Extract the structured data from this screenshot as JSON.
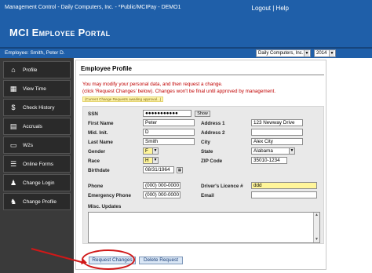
{
  "header": {
    "crumb": "Management Control - Daily Computers, Inc. - *Public/MCIPay - DEMO1",
    "logout": "Logout",
    "separator": "|",
    "help": "Help",
    "app_title": "MCI Employee Portal"
  },
  "employee_bar": {
    "employee": "Employee: Smith, Peter D.",
    "company": "Daily Computers, Inc.",
    "year": "2014"
  },
  "sidebar": {
    "items": [
      {
        "label": "Profile",
        "icon": "house-icon",
        "glyph": "⌂"
      },
      {
        "label": "View Time",
        "icon": "grid-icon",
        "glyph": "▦"
      },
      {
        "label": "Check History",
        "icon": "money-bag-icon",
        "glyph": "$"
      },
      {
        "label": "Accruals",
        "icon": "calendar-icon",
        "glyph": "▤"
      },
      {
        "label": "W2s",
        "icon": "document-icon",
        "glyph": "▭"
      },
      {
        "label": "Online Forms",
        "icon": "forms-icon",
        "glyph": "☰"
      },
      {
        "label": "Change Login",
        "icon": "person-icon",
        "glyph": "♟"
      },
      {
        "label": "Change Profile",
        "icon": "person-edit-icon",
        "glyph": "♞"
      }
    ]
  },
  "panel": {
    "title": "Employee Profile",
    "note1": "You may modify your personal data, and then request a change.",
    "note2": "(click 'Request Changes' below). Changes won't be final until approved by management.",
    "badge": "(Current Change Requests awaiting approval...)"
  },
  "form": {
    "ssn": {
      "label": "SSN",
      "value": "●●●●●●●●●●●",
      "show": "Show"
    },
    "first_name": {
      "label": "First Name",
      "value": "Peter"
    },
    "mid_init": {
      "label": "Mid. Init.",
      "value": "D"
    },
    "last_name": {
      "label": "Last Name",
      "value": "Smith"
    },
    "gender": {
      "label": "Gender",
      "value": "F"
    },
    "race": {
      "label": "Race",
      "value": "H"
    },
    "birthdate": {
      "label": "Birthdate",
      "value": "08/31/1964"
    },
    "address1": {
      "label": "Address 1",
      "value": "123 Newway Drive"
    },
    "address2": {
      "label": "Address 2",
      "value": ""
    },
    "city": {
      "label": "City",
      "value": "Alex City"
    },
    "state": {
      "label": "State",
      "value": "Alabama"
    },
    "zip": {
      "label": "ZIP Code",
      "value": "35010-1234"
    },
    "phone": {
      "label": "Phone",
      "value": "(000) 000-0000"
    },
    "emergency_phone": {
      "label": "Emergency Phone",
      "value": "(000) 000-0000"
    },
    "drivers_licence": {
      "label": "Driver's Licence #",
      "value": "ddd"
    },
    "email": {
      "label": "Email",
      "value": ""
    },
    "misc_updates": {
      "label": "Misc. Updates",
      "value": ""
    }
  },
  "buttons": {
    "request_changes": "Request Changes",
    "delete_request": "Delete Request"
  },
  "annotation_color": "#d01818"
}
